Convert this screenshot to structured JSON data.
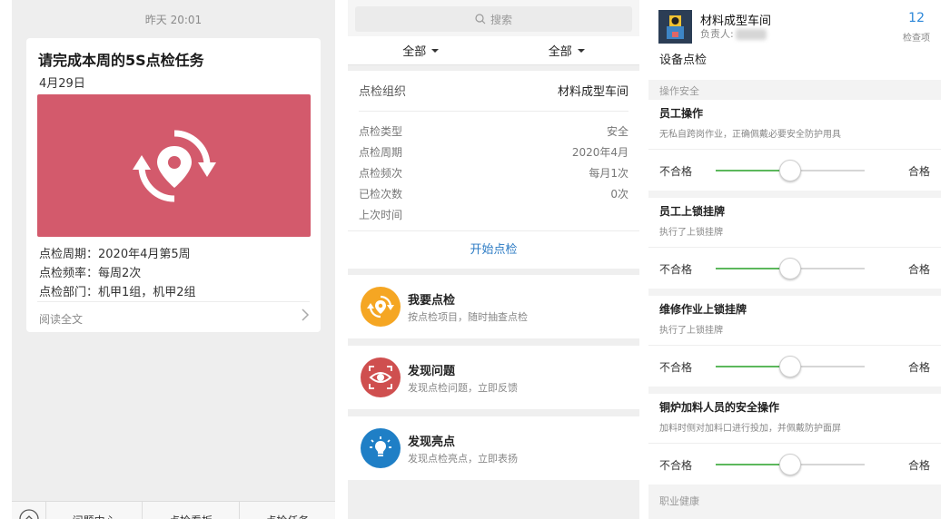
{
  "panel1": {
    "time": "昨天 20:01",
    "card": {
      "title": "请完成本周的5S点检任务",
      "date": "4月29日",
      "period": "点检周期：2020年4月第5周",
      "frequency": "点检频率：每周2次",
      "departments": "点检部门：机甲1组，机甲2组",
      "read_more": "阅读全文",
      "image_color": "#d35a6c"
    },
    "tabbar": {
      "items": [
        "问题中心",
        "点检看板",
        "点检任务"
      ]
    }
  },
  "panel2": {
    "search_placeholder": "搜索",
    "filters": [
      "全部",
      "全部"
    ],
    "org_label": "点检组织",
    "org_value": "材料成型车间",
    "rows": [
      {
        "label": "点检类型",
        "value": "安全"
      },
      {
        "label": "点检周期",
        "value": "2020年4月"
      },
      {
        "label": "点检频次",
        "value": "每月1次"
      },
      {
        "label": "已检次数",
        "value": "0次"
      },
      {
        "label": "上次时间",
        "value": ""
      }
    ],
    "start_label": "开始点检",
    "menu": [
      {
        "title": "我要点检",
        "subtitle": "按点检项目，随时抽查点检",
        "color": "#f5a623",
        "icon": "location-refresh-icon"
      },
      {
        "title": "发现问题",
        "subtitle": "发现点检问题，立即反馈",
        "color": "#cf4f4f",
        "icon": "eye-target-icon"
      },
      {
        "title": "发现亮点",
        "subtitle": "发现点检亮点，立即表扬",
        "color": "#1f7fc6",
        "icon": "lightbulb-icon"
      }
    ]
  },
  "panel3": {
    "workshop": "材料成型车间",
    "owner_label": "负责人:",
    "count": "12",
    "count_label": "检查项",
    "title": "设备点检",
    "section1": "操作安全",
    "section2": "职业健康",
    "items": [
      {
        "title": "员工操作",
        "desc": "无私自跨岗作业，正确佩戴必要安全防护用具",
        "left": "不合格",
        "right": "合格",
        "level": 0.5
      },
      {
        "title": "员工上锁挂牌",
        "desc": "执行了上锁挂牌",
        "left": "不合格",
        "right": "合格",
        "level": 0.5
      },
      {
        "title": "维修作业上锁挂牌",
        "desc": "执行了上锁挂牌",
        "left": "不合格",
        "right": "合格",
        "level": 0.5
      },
      {
        "title": "铜炉加料人员的安全操作",
        "desc": "加料时侧对加料口进行投加，并佩戴防护面屏",
        "left": "不合格",
        "right": "合格",
        "level": 0.5
      }
    ],
    "accent": "#5cb85c"
  }
}
